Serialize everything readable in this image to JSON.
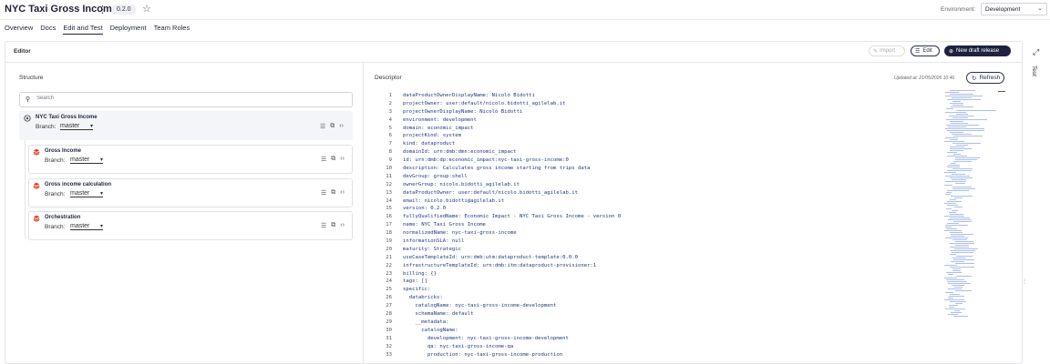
{
  "header": {
    "title": "NYC Taxi Gross Income",
    "version": "0.2.0",
    "environment_label": "Environment:",
    "environment_value": "Development"
  },
  "tabs": [
    {
      "label": "Overview"
    },
    {
      "label": "Docs"
    },
    {
      "label": "Edit and Test",
      "active": true
    },
    {
      "label": "Deployment"
    },
    {
      "label": "Team Roles"
    }
  ],
  "editor": {
    "title": "Editor",
    "import_label": "Import",
    "edit_label": "Edit",
    "draft_label": "New draft release"
  },
  "structure": {
    "title": "Structure",
    "search_placeholder": "Search",
    "branch_label": "Branch:",
    "root": {
      "name": "NYC Taxi Gross Income",
      "branch": "master"
    },
    "components": [
      {
        "name": "Gross Income",
        "branch": "master"
      },
      {
        "name": "Gross income calculation",
        "branch": "master"
      },
      {
        "name": "Orchestration",
        "branch": "master"
      }
    ]
  },
  "descriptor": {
    "title": "Descriptor",
    "updated": "Updated at: 21/05/2026 10:46",
    "refresh_label": "Refresh",
    "lines": [
      "dataProductOwnerDisplayName: Nicolò Bidotti",
      "projectOwner: user:default/nicolo.bidotti_agilelab.it",
      "projectOwnerDisplayName: Nicolò Bidotti",
      "environment: development",
      "domain: economic_impact",
      "projectKind: system",
      "kind: dataproduct",
      "domainId: urn:dmb:dmn:economic_impact",
      "id: urn:dmb:dp:economic_impact:nyc-taxi-gross-income:0",
      "description: Calculates gross income starting from trips data",
      "devGroup: group:shell",
      "ownerGroup: nicolo.bidotti_agilelab.it",
      "dataProductOwner: user:default/nicolo.bidotti_agilelab.it",
      "email: nicolo.bidotti@agilelab.it",
      "version: 0.2.0",
      "fullyQualifiedName: Economic Impact - NYC Taxi Gross Income - version 0",
      "name: NYC Taxi Gross Income",
      "normalizedName: nyc-taxi-gross-income",
      "informationSLA: null",
      "maturity: Strategic",
      "useCaseTemplateId: urn:dmb:utm:dataproduct-template:0.0.0",
      "infrastructureTemplateId: urn:dmb:itm:dataproduct-provisioner:1",
      "billing: {}",
      "tags: []",
      "specific:",
      "  databricks:",
      "    catalogName: nyc-taxi-gross-income-development",
      "    schemaName: default",
      "    __metadata:",
      "      catalogName:",
      "        development: nyc-taxi-gross-income-development",
      "        qa: nyc-taxi-gross-income-qa",
      "        production: nyc-taxi-gross-income-production"
    ]
  },
  "side_panel": {
    "test_label": "Test"
  }
}
